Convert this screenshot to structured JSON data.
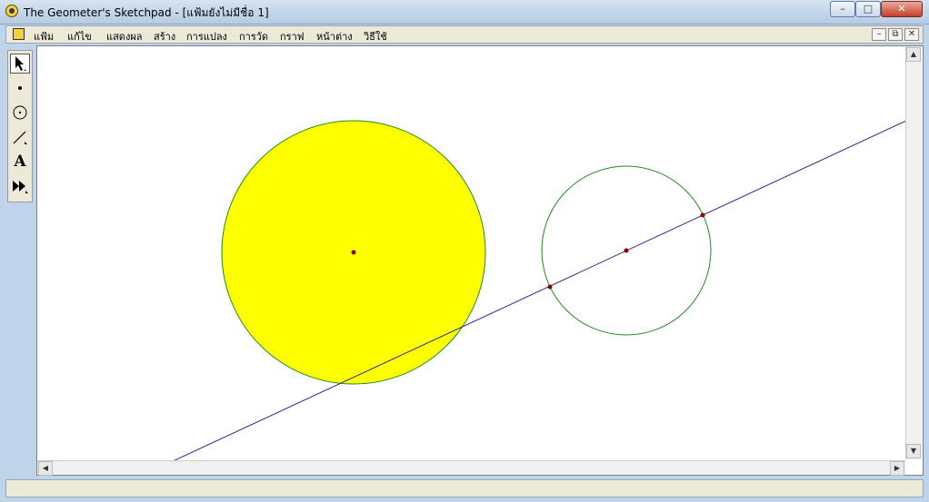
{
  "window": {
    "title": "The Geometer's Sketchpad - [แฟ้มยังไม่มีชื่อ 1]",
    "controls": {
      "minimize": "–",
      "maximize": "□",
      "close": "✕"
    }
  },
  "menu": {
    "items": [
      "แฟ้ม",
      "แก้ไข",
      "แสดงผล",
      "สร้าง",
      "การแปลง",
      "การวัด",
      "กราฟ",
      "หน้าต่าง",
      "วิธีใช้"
    ],
    "mdi": {
      "minimize": "–",
      "restore": "⧉",
      "close": "✕"
    }
  },
  "toolbox": {
    "tools": [
      "arrow-select-tool",
      "point-tool",
      "compass-tool",
      "straightedge-tool",
      "text-tool",
      "custom-tool"
    ],
    "text_tool_label": "A",
    "active_tool": "arrow-select-tool"
  },
  "sketch": {
    "colors": {
      "filled_circle": "#ffff00",
      "circle_stroke": "#228b22",
      "line": "#2b2b8c",
      "point": "#8b0000"
    }
  }
}
